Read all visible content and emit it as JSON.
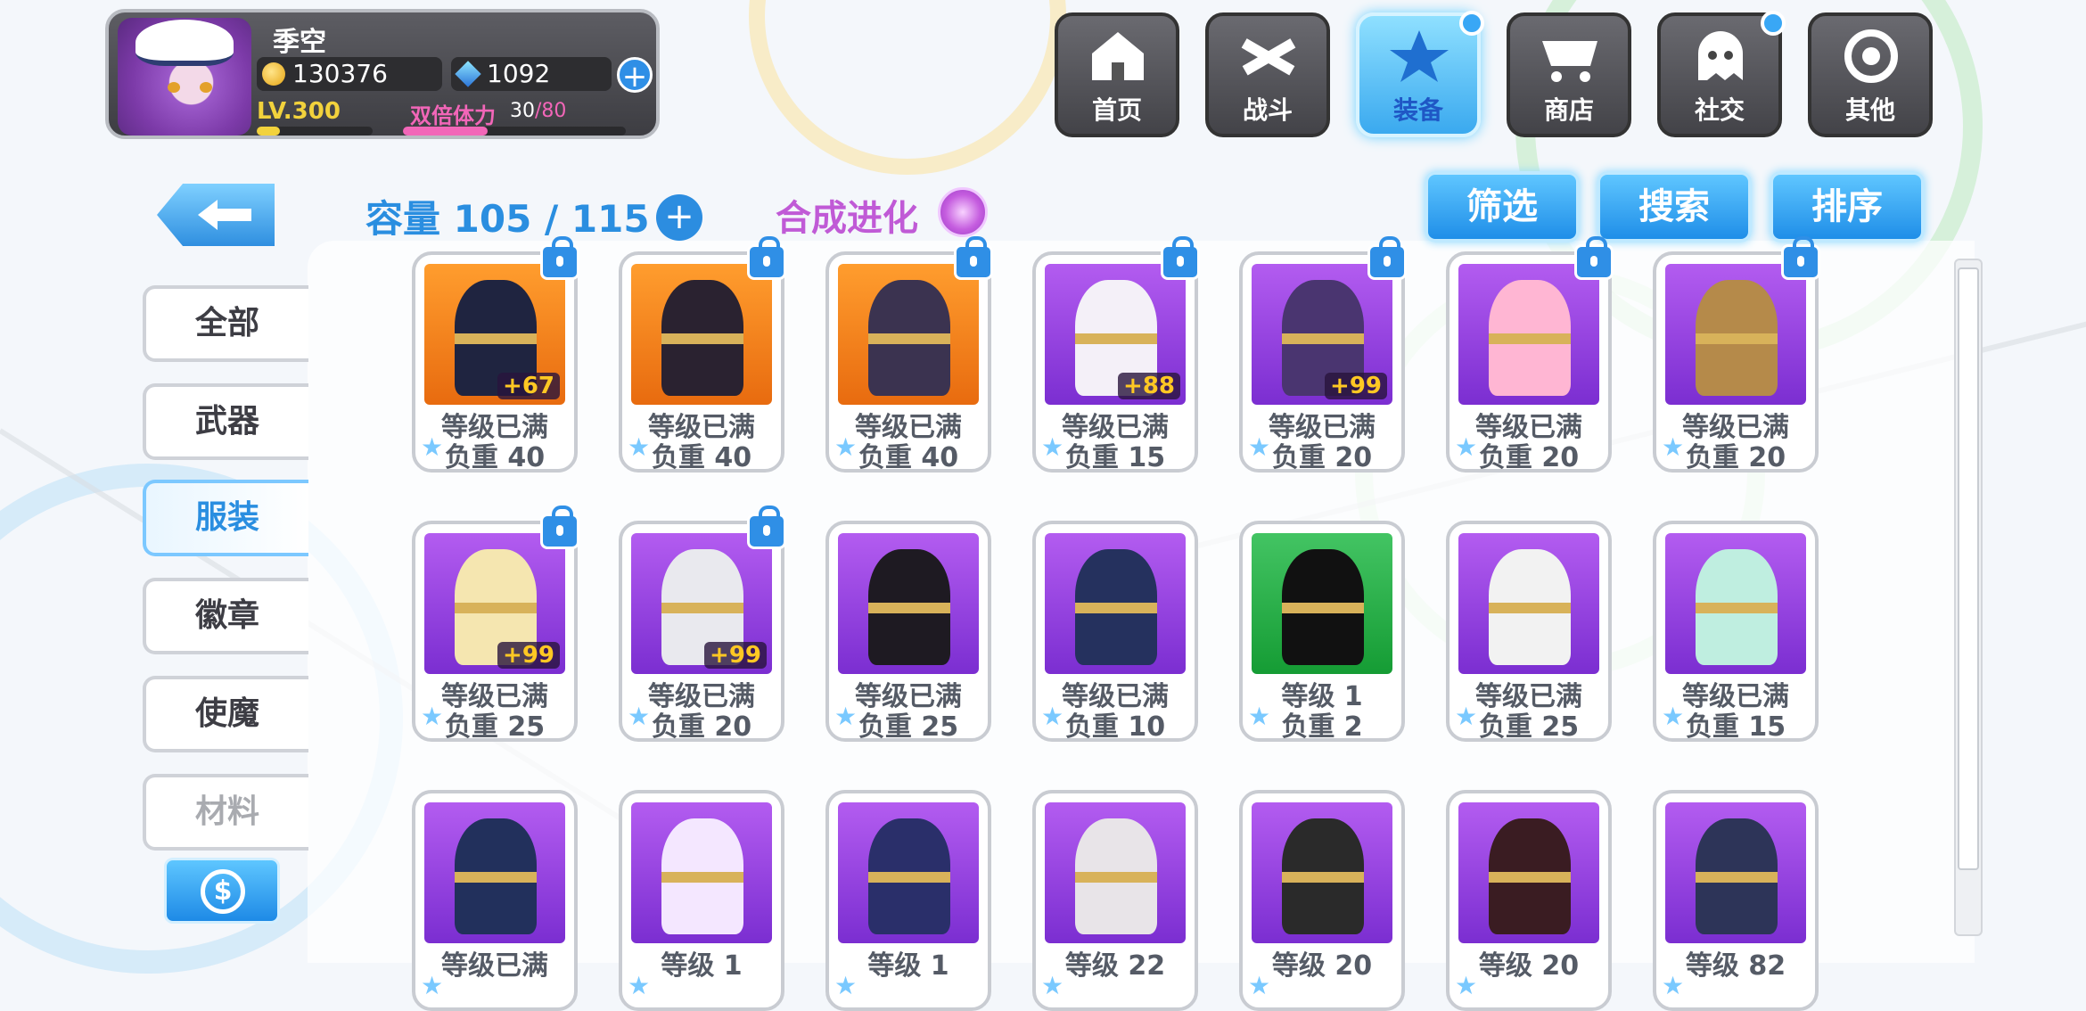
{
  "player": {
    "name": "季空",
    "gold": "130376",
    "gems": "1092",
    "level": "LV.300",
    "stamina_label": "双倍体力",
    "stamina_value": "30",
    "stamina_max": "/80"
  },
  "nav": [
    {
      "label": "首页",
      "icon": "house-icon"
    },
    {
      "label": "战斗",
      "icon": "crossed-swords-icon"
    },
    {
      "label": "装备",
      "icon": "star-gun-icon",
      "active": true
    },
    {
      "label": "商店",
      "icon": "shopping-cart-icon"
    },
    {
      "label": "社交",
      "icon": "ghost-face-icon"
    },
    {
      "label": "其他",
      "icon": "target-icon"
    }
  ],
  "inventory": {
    "capacity_text": "容量 105 / 115",
    "fusion_label": "合成进化"
  },
  "actions": {
    "filter": "筛选",
    "search": "搜索",
    "sort": "排序"
  },
  "categories": [
    "全部",
    "武器",
    "服装",
    "徽章",
    "使魔",
    "材料"
  ],
  "active_category": "服装",
  "colors": {
    "accent": "#2a8ee0",
    "fusion": "#c05ad6",
    "badge": "#ffc823"
  },
  "items": [
    {
      "line1": "等级已满",
      "line2": "负重 40",
      "badge": "+67",
      "locked": true,
      "bg": "orange"
    },
    {
      "line1": "等级已满",
      "line2": "负重 40",
      "badge": "",
      "locked": true,
      "bg": "orange"
    },
    {
      "line1": "等级已满",
      "line2": "负重 40",
      "badge": "",
      "locked": true,
      "bg": "orange"
    },
    {
      "line1": "等级已满",
      "line2": "负重 15",
      "badge": "+88",
      "locked": true,
      "bg": "purple"
    },
    {
      "line1": "等级已满",
      "line2": "负重 20",
      "badge": "+99",
      "locked": true,
      "bg": "purple"
    },
    {
      "line1": "等级已满",
      "line2": "负重 20",
      "badge": "",
      "locked": true,
      "bg": "purple"
    },
    {
      "line1": "等级已满",
      "line2": "负重 20",
      "badge": "",
      "locked": true,
      "bg": "purple"
    },
    {
      "line1": "等级已满",
      "line2": "负重 25",
      "badge": "+99",
      "locked": true,
      "bg": "purple"
    },
    {
      "line1": "等级已满",
      "line2": "负重 20",
      "badge": "+99",
      "locked": true,
      "bg": "purple"
    },
    {
      "line1": "等级已满",
      "line2": "负重 25",
      "badge": "",
      "locked": false,
      "bg": "purple"
    },
    {
      "line1": "等级已满",
      "line2": "负重 10",
      "badge": "",
      "locked": false,
      "bg": "purple"
    },
    {
      "line1": "等级 1",
      "line2": "负重 2",
      "badge": "",
      "locked": false,
      "bg": "green"
    },
    {
      "line1": "等级已满",
      "line2": "负重 25",
      "badge": "",
      "locked": false,
      "bg": "purple"
    },
    {
      "line1": "等级已满",
      "line2": "负重 15",
      "badge": "",
      "locked": false,
      "bg": "purple"
    },
    {
      "line1": "等级已满",
      "line2": "",
      "badge": "",
      "locked": false,
      "bg": "purple"
    },
    {
      "line1": "等级 1",
      "line2": "",
      "badge": "",
      "locked": false,
      "bg": "purple"
    },
    {
      "line1": "等级 1",
      "line2": "",
      "badge": "",
      "locked": false,
      "bg": "purple"
    },
    {
      "line1": "等级 22",
      "line2": "",
      "badge": "",
      "locked": false,
      "bg": "purple"
    },
    {
      "line1": "等级 20",
      "line2": "",
      "badge": "",
      "locked": false,
      "bg": "purple"
    },
    {
      "line1": "等级 20",
      "line2": "",
      "badge": "",
      "locked": false,
      "bg": "purple"
    },
    {
      "line1": "等级 82",
      "line2": "",
      "badge": "",
      "locked": false,
      "bg": "purple"
    }
  ]
}
